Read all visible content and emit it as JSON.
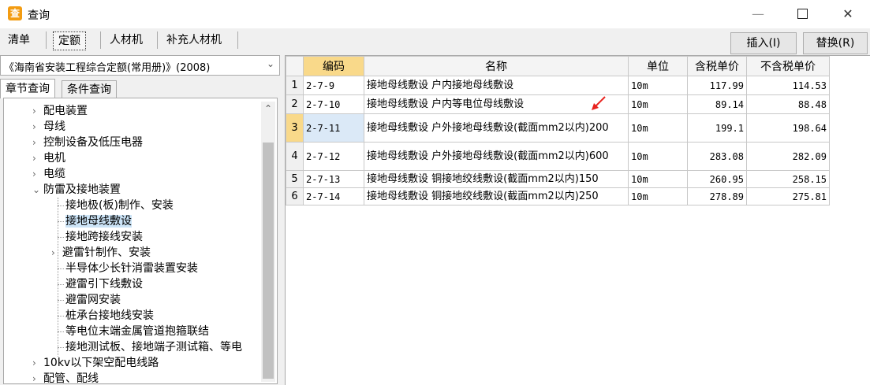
{
  "window": {
    "title": "查询",
    "icon": "query-app-icon",
    "controls": [
      "minimize",
      "maximize",
      "close"
    ]
  },
  "tabs": [
    {
      "label": "清单",
      "active": false
    },
    {
      "label": "定额",
      "active": true
    },
    {
      "label": "人材机",
      "active": false
    },
    {
      "label": "补充人材机",
      "active": false
    }
  ],
  "actions": {
    "insert_label": "插入(I)",
    "replace_label": "替换(R)"
  },
  "quota_book": {
    "selected": "《海南省安装工程综合定额(常用册)》(2008)"
  },
  "subtabs": [
    {
      "label": "章节查询",
      "active": true
    },
    {
      "label": "条件查询",
      "active": false
    }
  ],
  "tree": {
    "items": [
      {
        "label": "配电装置",
        "expander": "›"
      },
      {
        "label": "母线",
        "expander": "›"
      },
      {
        "label": "控制设备及低压电器",
        "expander": "›"
      },
      {
        "label": "电机",
        "expander": "›"
      },
      {
        "label": "电缆",
        "expander": "›"
      },
      {
        "label": "防雷及接地装置",
        "expander": "⌄"
      },
      {
        "label": "接地极(板)制作、安装",
        "expander": ""
      },
      {
        "label": "接地母线敷设",
        "expander": "",
        "selected": true
      },
      {
        "label": "接地跨接线安装",
        "expander": ""
      },
      {
        "label": "避雷针制作、安装",
        "expander": "›"
      },
      {
        "label": "半导体少长针消雷装置安装",
        "expander": ""
      },
      {
        "label": "避雷引下线敷设",
        "expander": ""
      },
      {
        "label": "避雷网安装",
        "expander": ""
      },
      {
        "label": "桩承台接地线安装",
        "expander": ""
      },
      {
        "label": "等电位末端金属管道抱箍联结",
        "expander": ""
      },
      {
        "label": "接地测试板、接地端子测试箱、等电",
        "expander": ""
      },
      {
        "label": "10kv以下架空配电线路",
        "expander": "›"
      },
      {
        "label": "配管、配线",
        "expander": "›"
      }
    ]
  },
  "table": {
    "headers": {
      "code": "编码",
      "name": "名称",
      "unit": "单位",
      "price_tax": "含税单价",
      "price_notax": "不含税单价"
    },
    "rows": [
      {
        "num": "1",
        "code": "2-7-9",
        "name": "接地母线敷设 户内接地母线敷设",
        "unit": "10m",
        "price_tax": "117.99",
        "price_notax": "114.53"
      },
      {
        "num": "2",
        "code": "2-7-10",
        "name": "接地母线敷设 户内等电位母线敷设",
        "unit": "10m",
        "price_tax": "89.14",
        "price_notax": "88.48"
      },
      {
        "num": "3",
        "code": "2-7-11",
        "name": "接地母线敷设 户外接地母线敷设(截面mm2以内)200",
        "unit": "10m",
        "price_tax": "199.1",
        "price_notax": "198.64",
        "active": true
      },
      {
        "num": "4",
        "code": "2-7-12",
        "name": "接地母线敷设 户外接地母线敷设(截面mm2以内)600",
        "unit": "10m",
        "price_tax": "283.08",
        "price_notax": "282.09"
      },
      {
        "num": "5",
        "code": "2-7-13",
        "name": "接地母线敷设 铜接地绞线敷设(截面mm2以内)150",
        "unit": "10m",
        "price_tax": "260.95",
        "price_notax": "258.15"
      },
      {
        "num": "6",
        "code": "2-7-14",
        "name": "接地母线敷设 铜接地绞线敷设(截面mm2以内)250",
        "unit": "10m",
        "price_tax": "278.89",
        "price_notax": "275.81"
      }
    ]
  },
  "colors": {
    "header_highlight": "#f9d98a",
    "selected_cell": "#dbe9f7",
    "tree_selected": "#cce4f7",
    "annotation_arrow": "#e8231f"
  }
}
